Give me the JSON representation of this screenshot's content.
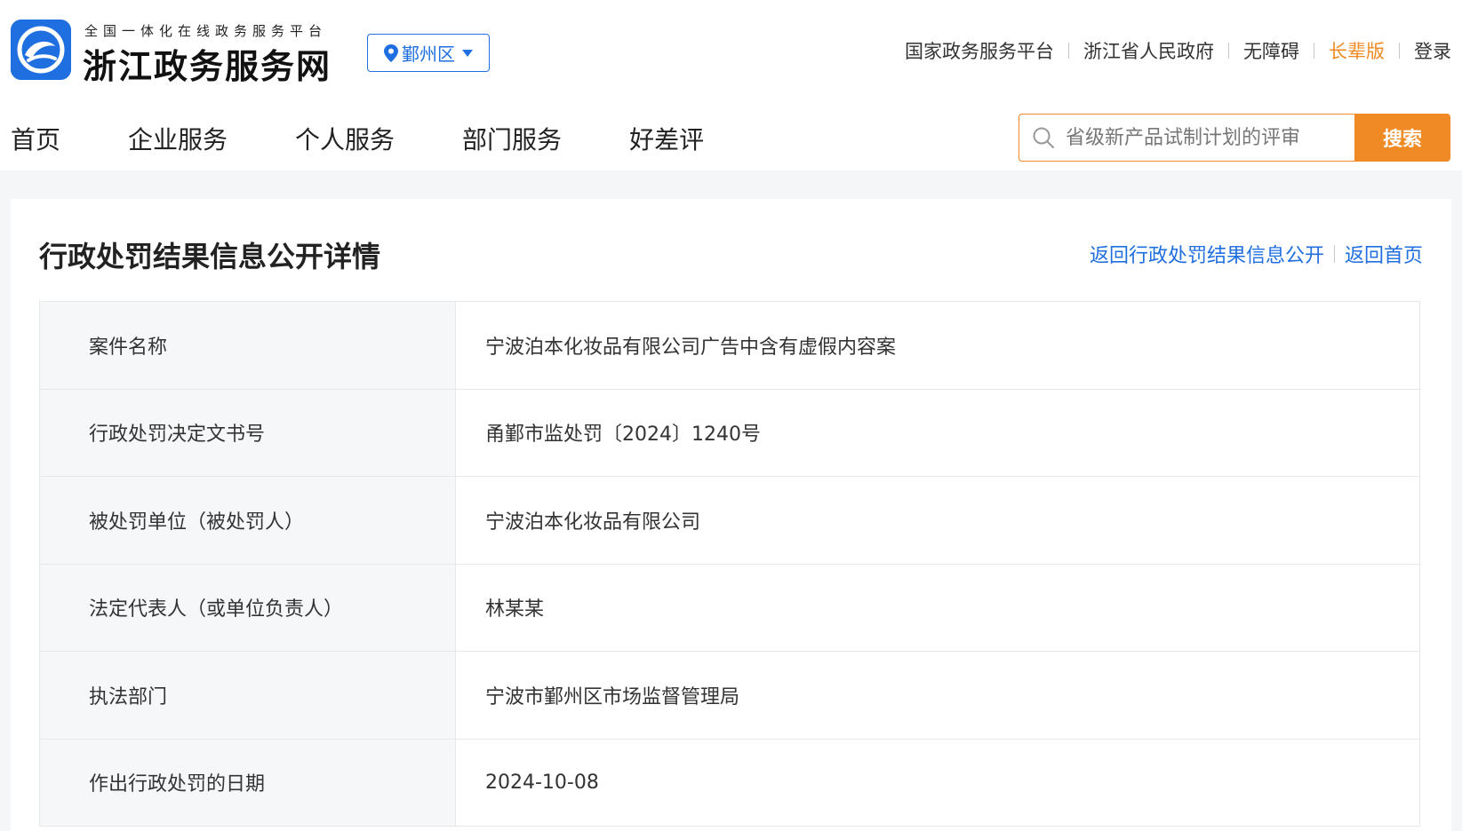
{
  "header": {
    "logo_subtitle": "全国一体化在线政务服务平台",
    "logo_title": "浙江政务服务网",
    "region": "鄞州区",
    "top_links": [
      {
        "label": "国家政务服务平台"
      },
      {
        "label": "浙江省人民政府"
      },
      {
        "label": "无障碍"
      },
      {
        "label": "长辈版"
      },
      {
        "label": "登录"
      }
    ],
    "nav": [
      "首页",
      "企业服务",
      "个人服务",
      "部门服务",
      "好差评"
    ],
    "search": {
      "placeholder": "省级新产品试制计划的评审",
      "button_label": "搜索"
    }
  },
  "colors": {
    "brand_blue": "#1f6fe0",
    "accent_orange": "#f08a24"
  },
  "page": {
    "title": "行政处罚结果信息公开详情",
    "back_links": [
      "返回行政处罚结果信息公开",
      "返回首页"
    ]
  },
  "details": [
    {
      "label": "案件名称",
      "value": "宁波泊本化妆品有限公司广告中含有虚假内容案"
    },
    {
      "label": "行政处罚决定文书号",
      "value": "甬鄞市监处罚〔2024〕1240号"
    },
    {
      "label": "被处罚单位（被处罚人）",
      "value": "宁波泊本化妆品有限公司"
    },
    {
      "label": "法定代表人（或单位负责人）",
      "value": "林某某"
    },
    {
      "label": "执法部门",
      "value": "宁波市鄞州区市场监督管理局"
    },
    {
      "label": "作出行政处罚的日期",
      "value": "2024-10-08"
    }
  ]
}
